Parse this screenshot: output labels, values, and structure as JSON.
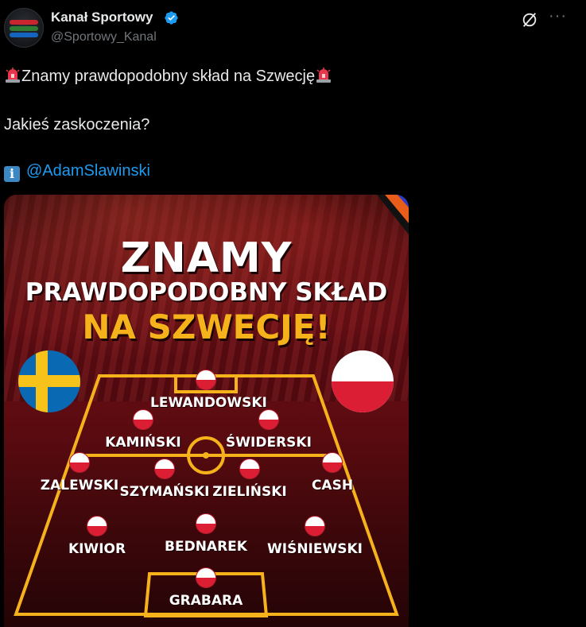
{
  "tweet": {
    "author_name": "Kanał Sportowy",
    "handle": "@Sportowy_Kanal",
    "line1": "Znamy prawdopodobny skład na Szwecję",
    "line2": "Jakieś zaskoczenia?",
    "info_icon_glyph": "i",
    "mention": "@AdamSlawinski",
    "siren_icon": "police-car-light-emoji",
    "info_icon": "information-emoji"
  },
  "icons": {
    "verified": "verified-badge-icon",
    "grok": "grok-icon",
    "more": "more-icon",
    "more_glyph": "···"
  },
  "colors": {
    "background": "#000000",
    "text": "#e7e9ea",
    "muted": "#71767b",
    "link": "#1d9bf0",
    "verified": "#1d9bf0",
    "poster_yellow": "#f6b21b",
    "pitch_line": "#f6b21b",
    "poland_red": "#dc1e35"
  },
  "poster": {
    "title_line1": "ZNAMY",
    "title_line2": "PRAWDOPODOBNY SKŁAD",
    "title_line3": "NA SZWECJĘ!",
    "players": {
      "lewandowski": "LEWANDOWSKI",
      "kaminski": "KAMIŃSKI",
      "swiderski": "ŚWIDERSKI",
      "zalewski": "ZALEWSKI",
      "szymanski": "SZYMAŃSKI",
      "zielinski": "ZIELIŃSKI",
      "cash": "CASH",
      "kiwior": "KIWIOR",
      "bednarek": "BEDNAREK",
      "wisniewski": "WIŚNIEWSKI",
      "grabara": "GRABARA"
    }
  }
}
